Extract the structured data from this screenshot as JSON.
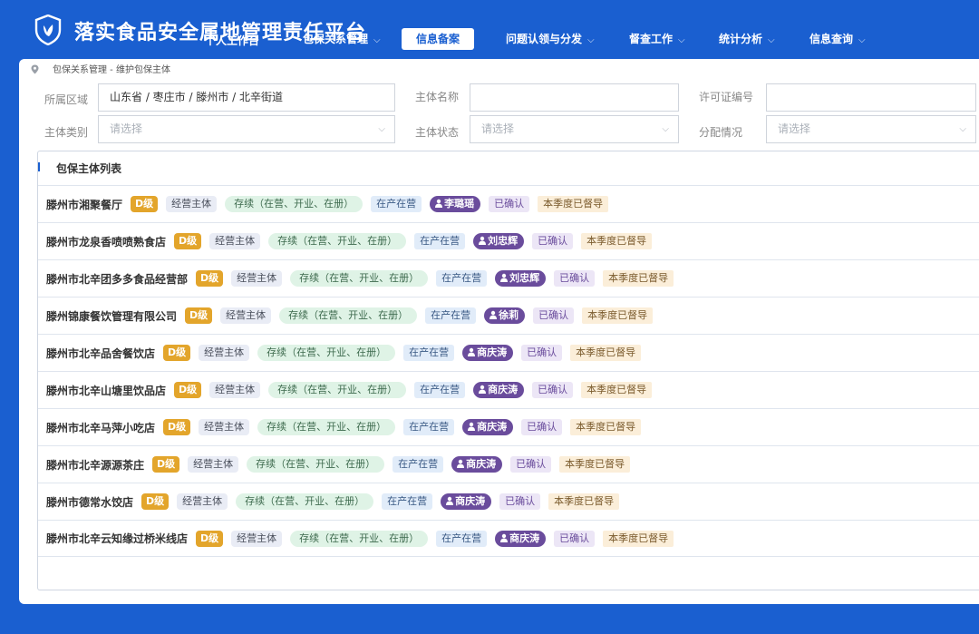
{
  "header": {
    "app_title": "落实食品安全属地管理责任平台",
    "overlap_label": "个人工作台",
    "nav": [
      {
        "label": "包保关系管理",
        "chevron": "⌵"
      },
      {
        "label": "信息备案",
        "chevron": ""
      },
      {
        "label": "问题认领与分发",
        "chevron": "⌵"
      },
      {
        "label": "督查工作",
        "chevron": "⌵"
      },
      {
        "label": "统计分析",
        "chevron": "⌵"
      },
      {
        "label": "信息查询",
        "chevron": "⌵"
      }
    ],
    "active_nav_index": 1,
    "brand_color": "#1a5fd0"
  },
  "breadcrumb": {
    "icon": "location-pin-icon",
    "text": "包保关系管理 - 维护包保主体"
  },
  "filters": {
    "region": {
      "label": "所属区域",
      "value": "山东省 / 枣庄市 / 滕州市 / 北辛街道"
    },
    "entity_name": {
      "label": "主体名称",
      "value": ""
    },
    "license_no": {
      "label": "许可证编号",
      "value": ""
    },
    "entity_type": {
      "label": "主体类别",
      "placeholder": "请选择"
    },
    "entity_status": {
      "label": "主体状态",
      "placeholder": "请选择"
    },
    "assignment": {
      "label": "分配情况",
      "placeholder": "请选择"
    },
    "dropdown_icon": "chevron-down-icon"
  },
  "list": {
    "title": "包保主体列表",
    "rows": [
      {
        "name": "滕州市湘聚餐厅",
        "level": "D级",
        "type": "经营主体",
        "status": "存续（在营、开业、在册）",
        "production": "在产在营",
        "person": "李璐瑶",
        "confirm": "已确认",
        "quarter": "本季度已督导"
      },
      {
        "name": "滕州市龙泉香喷喷熟食店",
        "level": "D级",
        "type": "经营主体",
        "status": "存续（在营、开业、在册）",
        "production": "在产在营",
        "person": "刘忠辉",
        "confirm": "已确认",
        "quarter": "本季度已督导"
      },
      {
        "name": "滕州市北辛团多多食品经营部",
        "level": "D级",
        "type": "经营主体",
        "status": "存续（在营、开业、在册）",
        "production": "在产在营",
        "person": "刘忠辉",
        "confirm": "已确认",
        "quarter": "本季度已督导"
      },
      {
        "name": "滕州锦康餐饮管理有限公司",
        "level": "D级",
        "type": "经营主体",
        "status": "存续（在营、开业、在册）",
        "production": "在产在营",
        "person": "徐莉",
        "confirm": "已确认",
        "quarter": "本季度已督导"
      },
      {
        "name": "滕州市北辛品舍餐饮店",
        "level": "D级",
        "type": "经营主体",
        "status": "存续（在营、开业、在册）",
        "production": "在产在营",
        "person": "商庆涛",
        "confirm": "已确认",
        "quarter": "本季度已督导"
      },
      {
        "name": "滕州市北辛山塘里饮品店",
        "level": "D级",
        "type": "经营主体",
        "status": "存续（在营、开业、在册）",
        "production": "在产在营",
        "person": "商庆涛",
        "confirm": "已确认",
        "quarter": "本季度已督导"
      },
      {
        "name": "滕州市北辛马萍小吃店",
        "level": "D级",
        "type": "经营主体",
        "status": "存续（在营、开业、在册）",
        "production": "在产在营",
        "person": "商庆涛",
        "confirm": "已确认",
        "quarter": "本季度已督导"
      },
      {
        "name": "滕州市北辛源源茶庄",
        "level": "D级",
        "type": "经营主体",
        "status": "存续（在营、开业、在册）",
        "production": "在产在营",
        "person": "商庆涛",
        "confirm": "已确认",
        "quarter": "本季度已督导"
      },
      {
        "name": "滕州市德常水饺店",
        "level": "D级",
        "type": "经营主体",
        "status": "存续（在营、开业、在册）",
        "production": "在产在营",
        "person": "商庆涛",
        "confirm": "已确认",
        "quarter": "本季度已督导"
      },
      {
        "name": "滕州市北辛云知缘过桥米线店",
        "level": "D级",
        "type": "经营主体",
        "status": "存续（在营、开业、在册）",
        "production": "在产在营",
        "person": "商庆涛",
        "confirm": "已确认",
        "quarter": "本季度已督导"
      }
    ]
  }
}
